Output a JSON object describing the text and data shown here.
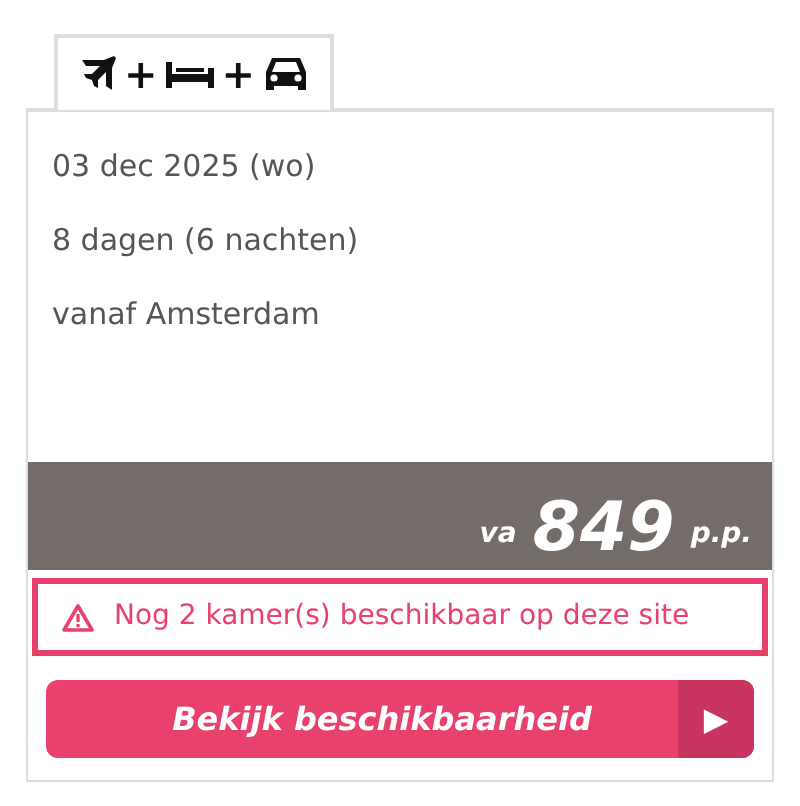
{
  "tab": {
    "selected": true,
    "icons": [
      {
        "kind": "plane"
      },
      {
        "kind": "bed"
      },
      {
        "kind": "car"
      }
    ],
    "separator": "+"
  },
  "details": [
    "03 dec 2025 (wo)",
    "8 dagen (6 nachten)",
    "vanaf Amsterdam"
  ],
  "price": {
    "prefix": "va",
    "amount": "849",
    "suffix": "p.p."
  },
  "alert": {
    "text": "Nog 2 kamer(s) beschikbaar op deze site"
  },
  "button": {
    "label": "Bekijk beschikbaarheid",
    "arrow": "▶"
  }
}
